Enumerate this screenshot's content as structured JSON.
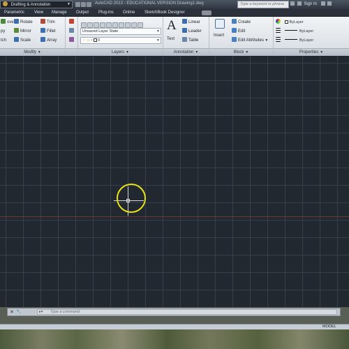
{
  "titlebar": {
    "workspace": "Drafting & Annotation",
    "app_title": "AutoCAD 2013 - EDUCATIONAL VERSION    Drawing1.dwg",
    "search_placeholder": "Type a keyword or phrase",
    "sign_in": "Sign In"
  },
  "tabs": [
    "Parametric",
    "View",
    "Manage",
    "Output",
    "Plug-ins",
    "Online",
    "SketchBook Designer"
  ],
  "ribbon": {
    "modify": {
      "title": "Modify",
      "items": [
        "Rotate",
        "Mirror",
        "Scale",
        "Trim",
        "Fillet",
        "Array"
      ],
      "cut_items": [
        "ove",
        "py",
        "tch"
      ]
    },
    "layers": {
      "title": "Layers",
      "layer_state": "Unsaved Layer State",
      "current_layer": "0"
    },
    "annotation": {
      "title": "Annotation",
      "text_label": "Text",
      "text_icon_glyph": "A",
      "items": [
        "Linear",
        "Leader",
        "Table"
      ]
    },
    "block": {
      "title": "Block",
      "insert_label": "Insert",
      "items": [
        "Create",
        "Edit",
        "Edit Attributes"
      ]
    },
    "properties": {
      "title": "Properties",
      "color": "ByLayer",
      "linetype": "ByLayer",
      "lineweight": "ByLayer"
    }
  },
  "command_line": {
    "placeholder": "Type a command"
  },
  "status_bar": {
    "model": "MODEL"
  },
  "colors": {
    "canvas_bg": "#212830",
    "snap_marker": "#e8e21a",
    "x_axis": "#7a3a2e"
  }
}
